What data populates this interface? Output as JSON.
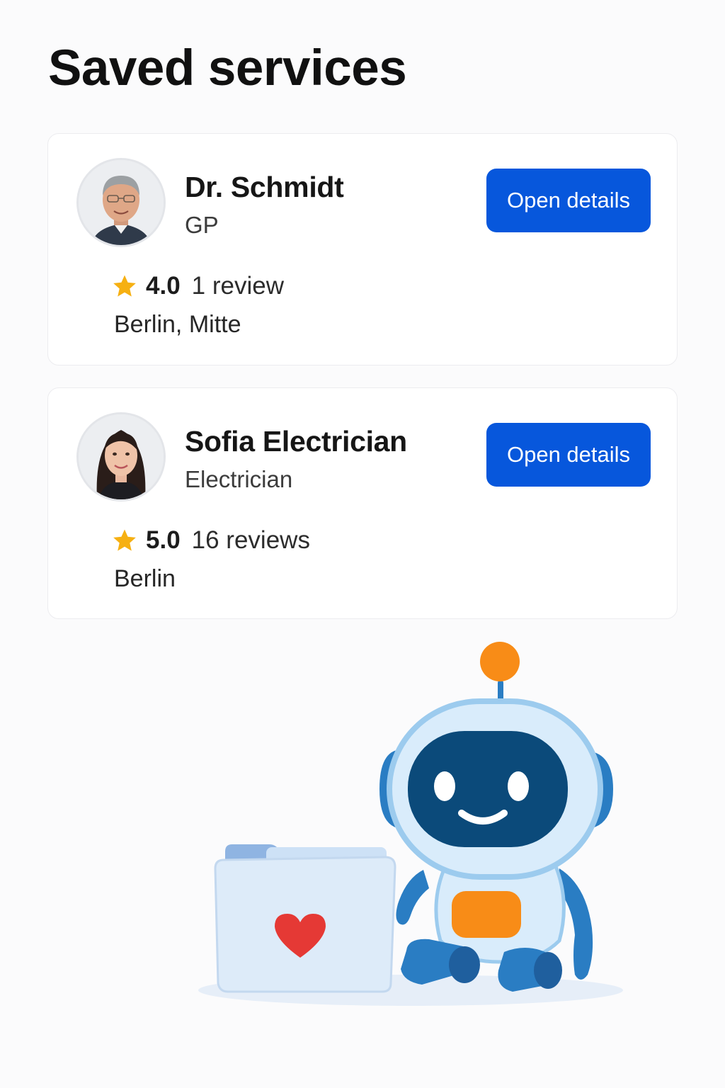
{
  "page": {
    "title": "Saved services"
  },
  "services": [
    {
      "name": "Dr. Schmidt",
      "category": "GP",
      "rating": "4.0",
      "reviews": "1 review",
      "location": "Berlin, Mitte",
      "button_label": "Open details",
      "avatar": "man-portrait-avatar"
    },
    {
      "name": "Sofia Electrician",
      "category": "Electrician",
      "rating": "5.0",
      "reviews": "16 reviews",
      "location": "Berlin",
      "button_label": "Open details",
      "avatar": "woman-portrait-avatar"
    }
  ],
  "icons": {
    "rating": "star-icon",
    "illustration": "robot-with-folder-heart-illustration"
  },
  "colors": {
    "accent": "#0757dc",
    "star": "#f6b012",
    "heart": "#e53935",
    "robot_body": "#d9ecfb",
    "robot_dark": "#1f6fb4",
    "robot_orange": "#f88c17"
  }
}
